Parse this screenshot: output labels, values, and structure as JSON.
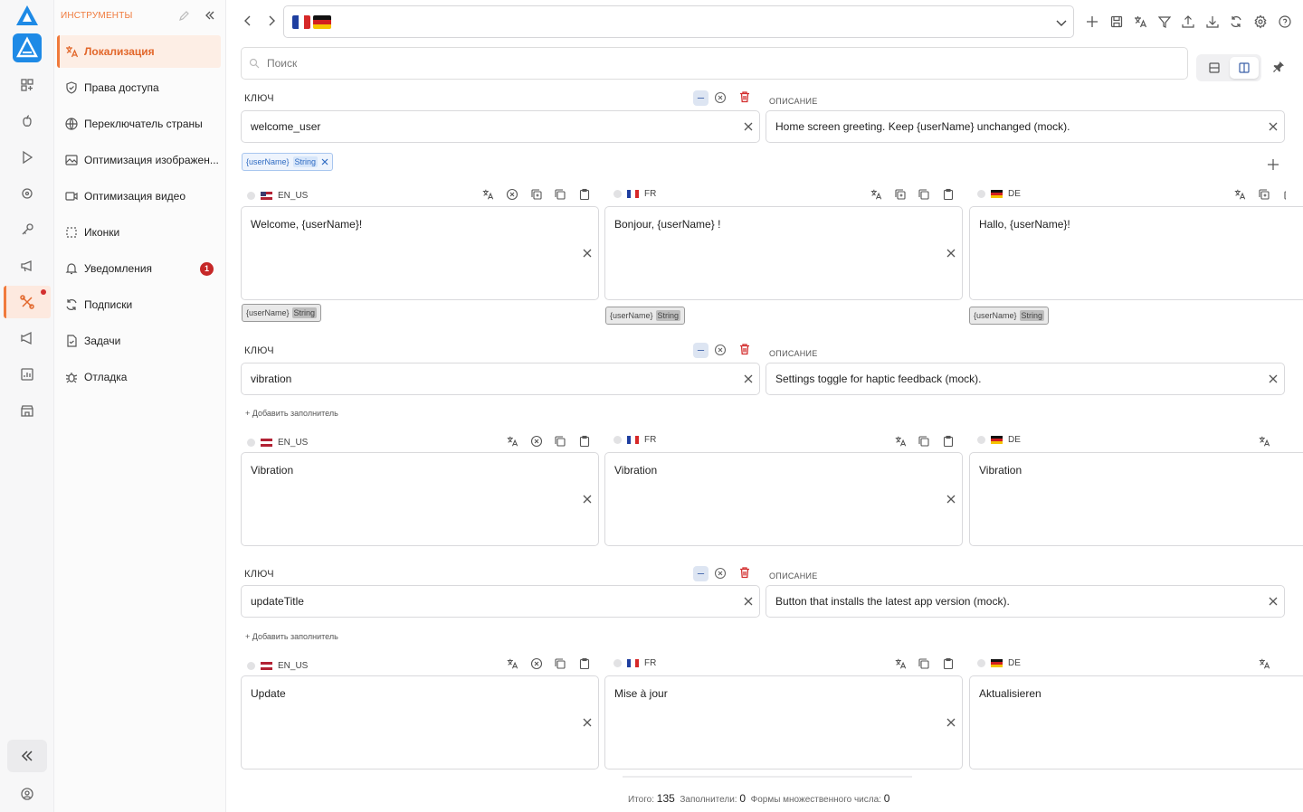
{
  "sidebar": {
    "title": "ИНСТРУМЕНТЫ",
    "items": [
      {
        "label": "Локализация",
        "icon": "translate-icon",
        "active": true
      },
      {
        "label": "Права доступа",
        "icon": "shield-icon"
      },
      {
        "label": "Переключатель страны",
        "icon": "globe-icon"
      },
      {
        "label": "Оптимизация изображен...",
        "icon": "image-icon"
      },
      {
        "label": "Оптимизация видео",
        "icon": "video-icon"
      },
      {
        "label": "Иконки",
        "icon": "dashed-square-icon"
      },
      {
        "label": "Уведомления",
        "icon": "bell-icon",
        "badge": "1"
      },
      {
        "label": "Подписки",
        "icon": "refresh-icon"
      },
      {
        "label": "Задачи",
        "icon": "file-check-icon"
      },
      {
        "label": "Отладка",
        "icon": "bug-icon"
      }
    ]
  },
  "search": {
    "placeholder": "Поиск"
  },
  "labels": {
    "key": "КЛЮЧ",
    "description": "ОПИСАНИЕ",
    "add_placeholder": "Добавить заполнитель"
  },
  "entries": [
    {
      "key": "welcome_user",
      "description": "Home screen greeting. Keep {userName} unchanged (mock).",
      "placeholder": {
        "name": "{userName}",
        "type": "String"
      },
      "translations": {
        "en": "Welcome, {userName}!",
        "fr": "Bonjour, {userName} !",
        "de": "Hallo, {userName}!"
      }
    },
    {
      "key": "vibration",
      "description": "Settings toggle for haptic feedback (mock).",
      "translations": {
        "en": "Vibration",
        "fr": "Vibration",
        "de": "Vibration"
      }
    },
    {
      "key": "updateTitle",
      "description": "Button that installs the latest app version (mock).",
      "translations": {
        "en": "Update",
        "fr": "Mise à jour",
        "de": "Aktualisieren"
      }
    }
  ],
  "langs": {
    "en": "EN_US",
    "fr": "FR",
    "de": "DE"
  },
  "footer": {
    "total_label": "Итого:",
    "total": "135",
    "placeholders_label": "Заполнители:",
    "placeholders": "0",
    "plurals_label": "Формы множественного числа:",
    "plurals": "0"
  },
  "colors": {
    "accent": "#f07a3c",
    "blue": "#1e8ae6",
    "danger": "#d32f2f"
  }
}
